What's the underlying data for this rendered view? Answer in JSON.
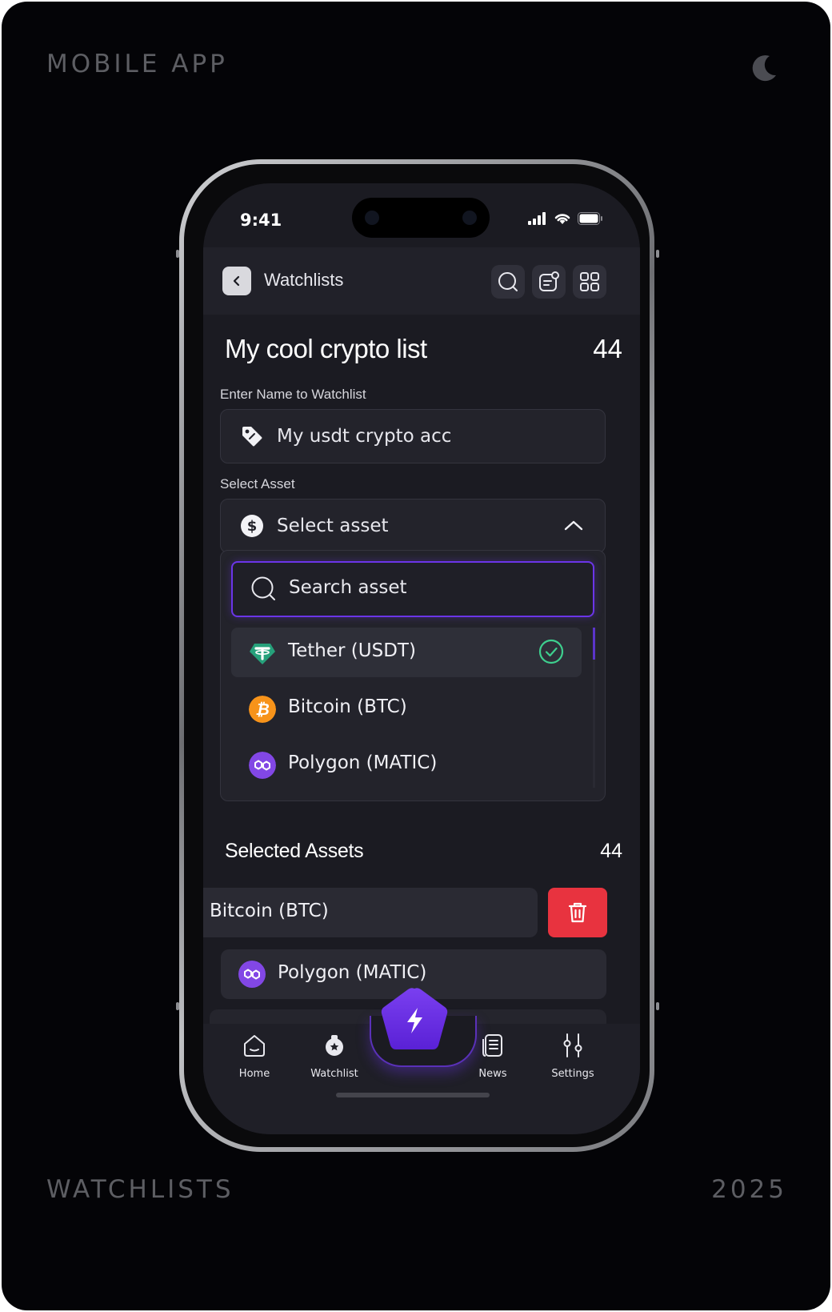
{
  "corner_labels": {
    "top_left": "MOBILE APP",
    "bottom_left": "WATCHLISTS",
    "bottom_right": "2025"
  },
  "status_bar": {
    "time": "9:41"
  },
  "app_bar": {
    "title": "Watchlists"
  },
  "list_header": {
    "title": "My cool crypto list",
    "count": "44"
  },
  "name_field": {
    "label": "Enter Name to Watchlist",
    "value": "My usdt crypto acc"
  },
  "asset_field": {
    "label": "Select Asset",
    "placeholder": "Select asset"
  },
  "dropdown": {
    "search_placeholder": "Search asset",
    "options": [
      {
        "label": "Tether (USDT)",
        "icon": "tether-icon",
        "color": "#26a17b",
        "selected": true
      },
      {
        "label": "Bitcoin (BTC)",
        "icon": "bitcoin-icon",
        "color": "#f7931a",
        "selected": false
      },
      {
        "label": "Polygon (MATIC)",
        "icon": "polygon-icon",
        "color": "#8247e5",
        "selected": false
      }
    ]
  },
  "selected_assets": {
    "title": "Selected Assets",
    "count": "44",
    "items": [
      {
        "label": "Bitcoin (BTC)"
      },
      {
        "label": "Polygon (MATIC)"
      }
    ]
  },
  "tab_bar": {
    "tabs": [
      {
        "label": "Home",
        "icon": "home-icon"
      },
      {
        "label": "Watchlist",
        "icon": "watchlist-icon"
      },
      {
        "label": "News",
        "icon": "news-icon"
      },
      {
        "label": "Settings",
        "icon": "settings-icon"
      }
    ]
  },
  "colors": {
    "accent": "#6b35e8",
    "danger": "#e8333f",
    "success": "#3ecf8e"
  }
}
